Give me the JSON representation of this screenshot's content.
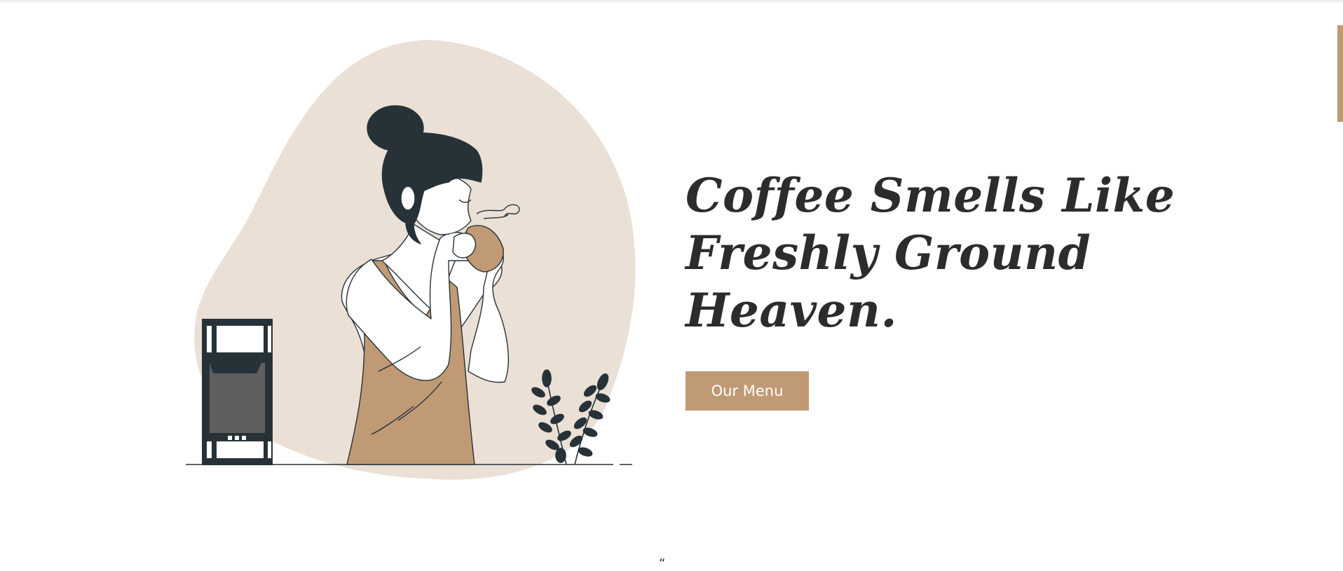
{
  "hero": {
    "title_line1": "Coffee Smells Like",
    "title_line2": "Freshly Ground Heaven.",
    "cta_label": "Our Menu"
  },
  "bottom_mark": "“",
  "colors": {
    "accent": "#c09a74",
    "blob": "#ebe0d6",
    "dark": "#263238",
    "text": "#2c2c2c"
  }
}
